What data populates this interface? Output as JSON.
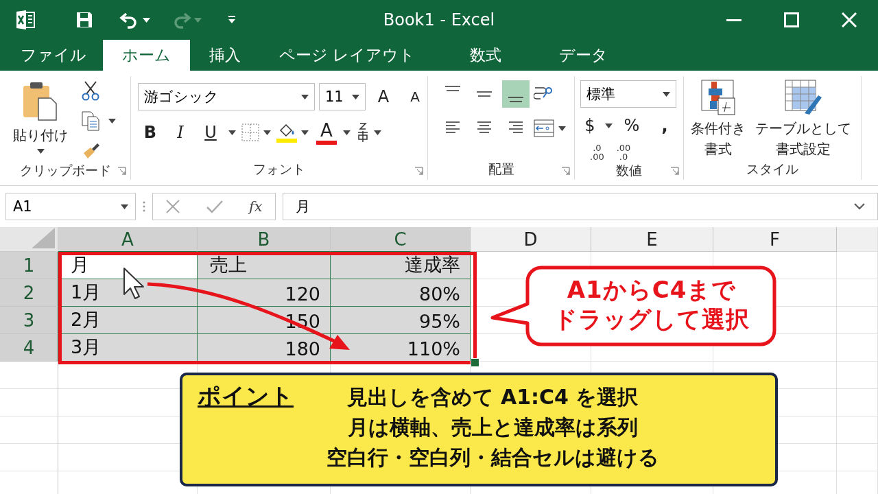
{
  "window": {
    "title": "Book1 - Excel"
  },
  "tabs": [
    {
      "label": "ファイル",
      "selected": false
    },
    {
      "label": "ホーム",
      "selected": true
    },
    {
      "label": "挿入",
      "selected": false
    },
    {
      "label": "ページ レイアウト",
      "selected": false
    },
    {
      "label": "数式",
      "selected": false
    },
    {
      "label": "データ",
      "selected": false
    }
  ],
  "ribbon": {
    "clipboard": {
      "label": "クリップボード",
      "paste": "貼り付け"
    },
    "font": {
      "label": "フォント",
      "font_name": "游ゴシック",
      "font_size": "11",
      "grow": "A",
      "shrink": "A",
      "bold": "B",
      "italic": "I",
      "underline": "U",
      "font_color": "A"
    },
    "alignment": {
      "label": "配置",
      "vertical_align": [
        {
          "selected": false
        },
        {
          "selected": false
        },
        {
          "selected": true
        }
      ]
    },
    "number": {
      "label": "数値",
      "format": "標準",
      "currency": "$",
      "percent": "%",
      "comma": ",",
      "increase_decimal": {
        "top": ".0",
        "bottom": ".00"
      },
      "decrease_decimal": {
        "top": ".00",
        "bottom": ".0"
      }
    },
    "styles": {
      "label": "スタイル",
      "conditional": [
        "条件付き",
        "書式"
      ],
      "table": [
        "テーブルとして",
        "書式設定"
      ]
    }
  },
  "formula_bar": {
    "name_box": "A1",
    "fx": "fx",
    "value": "月"
  },
  "columns": [
    {
      "label": "A",
      "selected": true
    },
    {
      "label": "B",
      "selected": true
    },
    {
      "label": "C",
      "selected": true
    },
    {
      "label": "D",
      "selected": false
    },
    {
      "label": "E",
      "selected": false
    },
    {
      "label": "F",
      "selected": false
    }
  ],
  "rows": [
    {
      "label": "1",
      "selected": true,
      "cells": [
        {
          "text": "月",
          "active": true
        },
        {
          "text": "売上",
          "active": false
        },
        {
          "text": "達成率",
          "active": false
        }
      ]
    },
    {
      "label": "2",
      "selected": true,
      "cells": [
        {
          "text": "1月",
          "active": false
        },
        {
          "text": "120",
          "active": false
        },
        {
          "text": "80%",
          "active": false
        }
      ]
    },
    {
      "label": "3",
      "selected": true,
      "cells": [
        {
          "text": "2月",
          "active": false
        },
        {
          "text": "150",
          "active": false
        },
        {
          "text": "95%",
          "active": false
        }
      ]
    },
    {
      "label": "4",
      "selected": true,
      "cells": [
        {
          "text": "3月",
          "active": false
        },
        {
          "text": "180",
          "active": false
        },
        {
          "text": "110%",
          "active": false
        }
      ]
    }
  ],
  "callout": {
    "lines": [
      "A1からC4まで",
      "ドラッグして選択"
    ]
  },
  "point": {
    "heading": "ポイント",
    "lines": [
      "見出しを含めて A1:C4 を選択",
      "月は横軸、売上と達成率は系列",
      "空白行・空白列・結合セルは避ける"
    ]
  }
}
